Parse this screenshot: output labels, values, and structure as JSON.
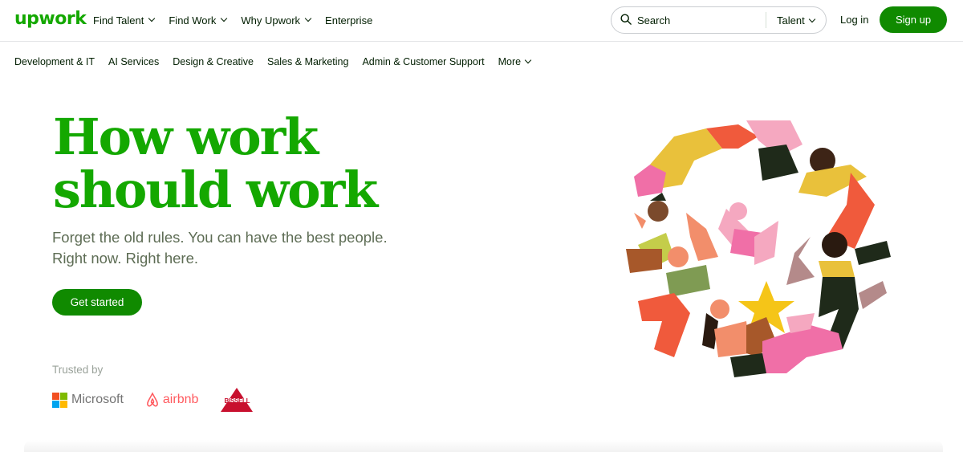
{
  "header": {
    "logo": "upwork",
    "nav": [
      {
        "label": "Find Talent",
        "dropdown": true
      },
      {
        "label": "Find Work",
        "dropdown": true
      },
      {
        "label": "Why Upwork",
        "dropdown": true
      },
      {
        "label": "Enterprise",
        "dropdown": false
      }
    ],
    "search": {
      "placeholder": "Search",
      "type": "Talent"
    },
    "login": "Log in",
    "signup": "Sign up"
  },
  "categories": [
    "Development & IT",
    "AI Services",
    "Design & Creative",
    "Sales & Marketing",
    "Admin & Customer Support",
    "More"
  ],
  "hero": {
    "title_line1": "How work",
    "title_line2": "should work",
    "subtitle_line1": "Forget the old rules. You can have the best people.",
    "subtitle_line2": "Right now. Right here.",
    "cta": "Get started"
  },
  "trusted": {
    "label": "Trusted by",
    "logos": [
      "Microsoft",
      "airbnb",
      "BISSELL"
    ]
  },
  "colors": {
    "brand_green": "#14a800",
    "button_green": "#108a00",
    "subtitle_gray": "#5e6d55"
  }
}
